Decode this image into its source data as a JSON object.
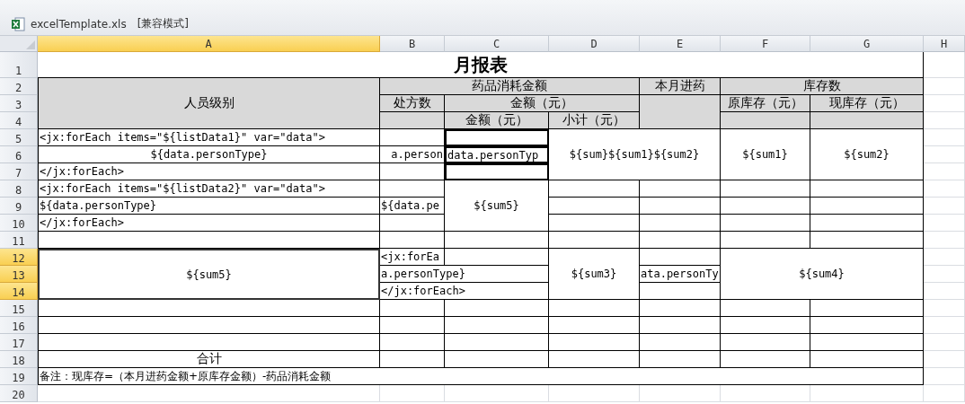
{
  "window": {
    "title": "excelTemplate.xls",
    "mode": "[兼容模式]"
  },
  "columns": [
    {
      "label": "A",
      "selected": true
    },
    {
      "label": "B",
      "selected": false
    },
    {
      "label": "C",
      "selected": false
    },
    {
      "label": "D",
      "selected": false
    },
    {
      "label": "E",
      "selected": false
    },
    {
      "label": "F",
      "selected": false
    },
    {
      "label": "G",
      "selected": false
    },
    {
      "label": "H",
      "selected": false
    }
  ],
  "rows": [
    {
      "label": "1",
      "selected": false
    },
    {
      "label": "2",
      "selected": false
    },
    {
      "label": "3",
      "selected": false
    },
    {
      "label": "4",
      "selected": false
    },
    {
      "label": "5",
      "selected": false
    },
    {
      "label": "6",
      "selected": false
    },
    {
      "label": "7",
      "selected": false
    },
    {
      "label": "8",
      "selected": false
    },
    {
      "label": "9",
      "selected": false
    },
    {
      "label": "10",
      "selected": false
    },
    {
      "label": "11",
      "selected": false
    },
    {
      "label": "12",
      "selected": true
    },
    {
      "label": "13",
      "selected": true
    },
    {
      "label": "14",
      "selected": true
    },
    {
      "label": "15",
      "selected": false
    },
    {
      "label": "16",
      "selected": false
    },
    {
      "label": "17",
      "selected": false
    },
    {
      "label": "18",
      "selected": false
    },
    {
      "label": "19",
      "selected": false
    },
    {
      "label": "20",
      "selected": false
    }
  ],
  "cells": [
    {
      "text": "月报表"
    },
    {
      "text": "人员级别"
    },
    {
      "text": "药品消耗金额"
    },
    {
      "text": "本月进药"
    },
    {
      "text": "库存数"
    },
    {
      "text": "处方数"
    },
    {
      "text": "金额（元）"
    },
    {
      "text": "原库存（元）"
    },
    {
      "text": "现库存（元）"
    },
    {
      "text": "金额（元）"
    },
    {
      "text": "小计（元）"
    },
    {
      "text": "<jx:forEach items=\"${listData1}\" var=\"data\">"
    },
    {
      "text": "${data.personType}"
    },
    {
      "text": "</jx:forEach>"
    },
    {
      "text": "a.person"
    },
    {
      "text": "data.personTyp"
    },
    {
      "text": "${sum}${sum1}${sum2}"
    },
    {
      "text": "${sum1}"
    },
    {
      "text": "${sum2}"
    },
    {
      "text": "<jx:forEach items=\"${listData2}\" var=\"data\">"
    },
    {
      "text": "${data.personType}"
    },
    {
      "text": "</jx:forEach>"
    },
    {
      "text": "${data.pe"
    },
    {
      "text": "${sum5}"
    },
    {
      "text": "${sum5}"
    },
    {
      "text": "<jx:forEa"
    },
    {
      "text": "a.personType}"
    },
    {
      "text": "</jx:forEach>"
    },
    {
      "text": "${sum3}"
    },
    {
      "text": "ata.personTy"
    },
    {
      "text": "${sum4}"
    },
    {
      "text": "合计"
    },
    {
      "text": "备注：现库存=（本月进药金额+原库存金额）-药品消耗金额"
    }
  ]
}
